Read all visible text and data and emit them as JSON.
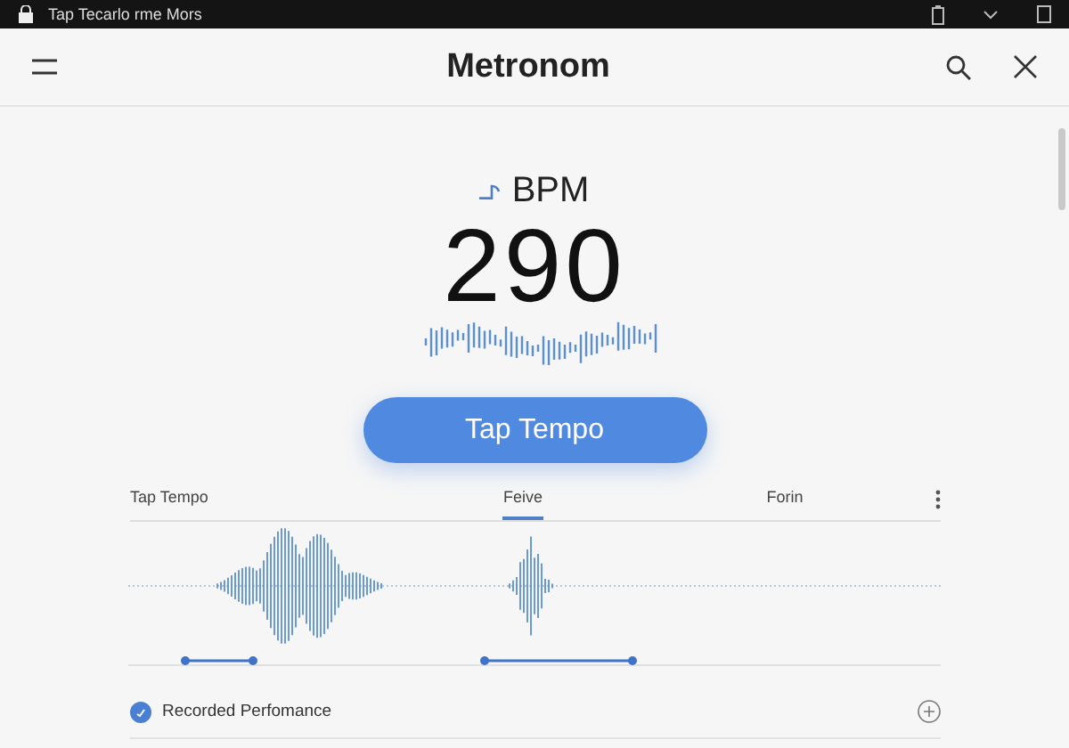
{
  "status_bar": {
    "title": "Tap Tecarlo rme Mors"
  },
  "app_bar": {
    "title": "Metronom"
  },
  "tempo": {
    "unit": "BPM",
    "value": "290"
  },
  "tap_button": {
    "label": "Tap Tempo"
  },
  "tabs": [
    {
      "label": "Tap Tempo",
      "selected": false
    },
    {
      "label": "Feive",
      "selected": true
    },
    {
      "label": "Forin",
      "selected": false
    }
  ],
  "list": [
    {
      "label": "Recorded Perfomance",
      "checked": true
    }
  ]
}
